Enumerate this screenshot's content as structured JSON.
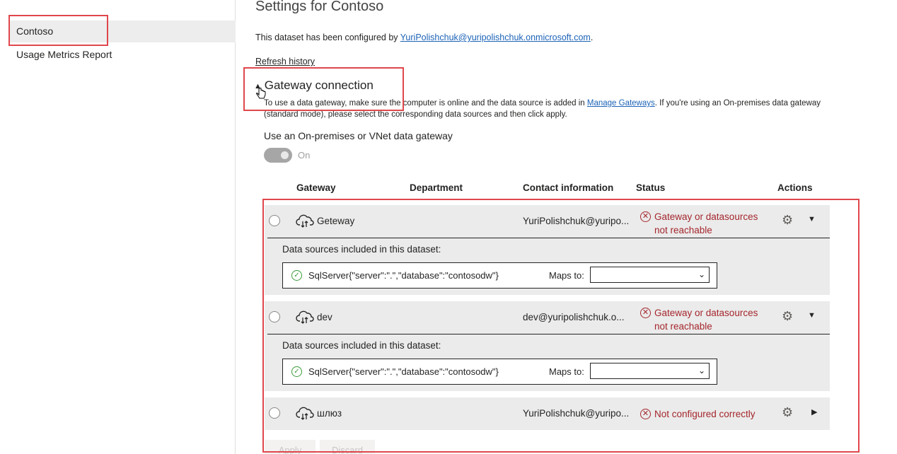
{
  "sidebar": {
    "items": [
      {
        "label": "Contoso",
        "selected": true
      },
      {
        "label": "Usage Metrics Report",
        "selected": false
      }
    ]
  },
  "main": {
    "title": "Settings for Contoso",
    "configured_prefix": "This dataset has been configured by ",
    "configured_email": "YuriPolishchuk@yuripolishchuk.onmicrosoft.com",
    "configured_suffix": ".",
    "refresh_history": "Refresh history",
    "gateway": {
      "header": "Gateway connection",
      "desc_prefix": "To use a data gateway, make sure the computer is online and the data source is added in ",
      "desc_link": "Manage Gateways",
      "desc_suffix": ". If you're using an On-premises data gateway (standard mode), please select the corresponding data sources and then click apply.",
      "use_label": "Use an On-premises or VNet data gateway",
      "toggle_label": "On",
      "toggle_on": true
    },
    "table": {
      "headers": [
        "Gateway",
        "Department",
        "Contact information",
        "Status",
        "Actions"
      ],
      "rows": [
        {
          "name": "Geteway",
          "contact": "YuriPolishchuk@yuripo...",
          "status": "Gateway or datasources not reachable",
          "expanded": true,
          "ds_title": "Data sources included in this dataset:",
          "ds_name": "SqlServer{\"server\":\".\",\"database\":\"contosodw\"}",
          "maps_label": "Maps to:",
          "maps_value": ""
        },
        {
          "name": "dev",
          "contact": "dev@yuripolishchuk.o...",
          "status": "Gateway or datasources not reachable",
          "expanded": true,
          "ds_title": "Data sources included in this dataset:",
          "ds_name": "SqlServer{\"server\":\".\",\"database\":\"contosodw\"}",
          "maps_label": "Maps to:",
          "maps_value": ""
        },
        {
          "name": "шлюз",
          "contact": "YuriPolishchuk@yuripo...",
          "status": "Not configured correctly",
          "expanded": false
        }
      ]
    },
    "buttons": {
      "apply": "Apply",
      "discard": "Discard"
    }
  },
  "colors": {
    "annotation_red": "#e0474c",
    "error_red": "#a4262c",
    "link_blue": "#1c63b7",
    "success_green": "#3a9c3a",
    "row_bg": "#ebebeb"
  },
  "icons": [
    "cloud-gateway-icon",
    "error-circle-icon",
    "gear-icon",
    "chevron-down-icon",
    "chevron-right-icon",
    "check-circle-icon",
    "caret-up-icon",
    "hand-cursor-icon"
  ]
}
